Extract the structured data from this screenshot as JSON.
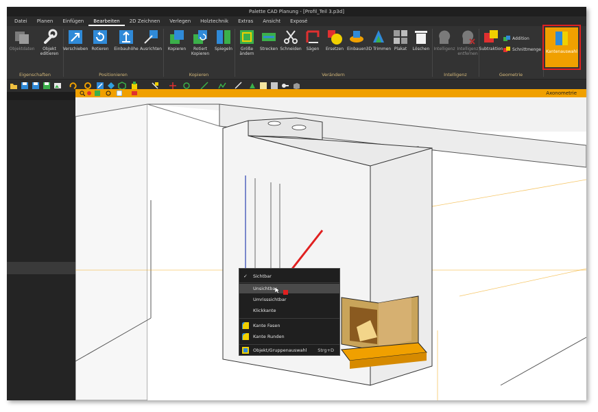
{
  "window": {
    "title": "Palette CAD Planung - [Profil_Teil 3.p3d]"
  },
  "menu": [
    "Datei",
    "Planen",
    "Einfügen",
    "Bearbeiten",
    "2D Zeichnen",
    "Verlegen",
    "Holztechnik",
    "Extras",
    "Ansicht",
    "Exposé"
  ],
  "menu_active": "Bearbeiten",
  "ribbon": {
    "buttons": {
      "objektdaten": "Objektdaten",
      "objekt_editieren": "Objekt editieren",
      "verschieben": "Verschieben",
      "rotieren": "Rotieren",
      "einbauhoehe": "Einbauhöhe",
      "ausrichten": "Ausrichten",
      "kopieren": "Kopieren",
      "rotiert_kopieren": "Rotiert Kopieren",
      "spiegeln": "Spiegeln",
      "groesse_aendern": "Größe ändern",
      "strecken": "Strecken",
      "schneiden": "Schneiden",
      "saegen": "Sägen",
      "ersetzen": "Ersetzen",
      "einbauen": "Einbauen",
      "trimmen_3d": "3D Trimmen",
      "plakat": "Plakat",
      "loeschen": "Löschen",
      "intelligenz": "Intelligenz",
      "intelligenz_entfernen": "Intelligenz entfernen",
      "subtraktion": "Subtraktion",
      "addition": "Addition",
      "schnittmenge": "Schnittmenge",
      "kantenauswahl": "Kantenauswahl"
    },
    "groups": {
      "eigenschaften": "Eigenschaften",
      "positionieren": "Positionieren",
      "kopieren": "Kopieren",
      "veraendern": "Verändern",
      "intelligenz": "Intelligenz",
      "geometrie": "Geometrie"
    }
  },
  "view": {
    "name": "Axonometrie"
  },
  "context_menu": {
    "items": {
      "sichtbar": "Sichtbar",
      "unsichtbar": "Unsichtbar",
      "umrisssichtbar": "Umrisssichtbar",
      "klickkante": "Klickkante",
      "kante_fasen": "Kante Fasen",
      "kante_runden": "Kante Runden",
      "objekt_gruppenauswahl": "Objekt/Gruppenauswahl"
    },
    "shortcut": "Strg+D",
    "checked_item": "Sichtbar",
    "hovered_item": "Unsichtbar"
  },
  "colors": {
    "accent": "#f0a000",
    "ribbon_bg": "#333333",
    "highlight_box": "#e02020",
    "group_label": "#d4b87a"
  }
}
